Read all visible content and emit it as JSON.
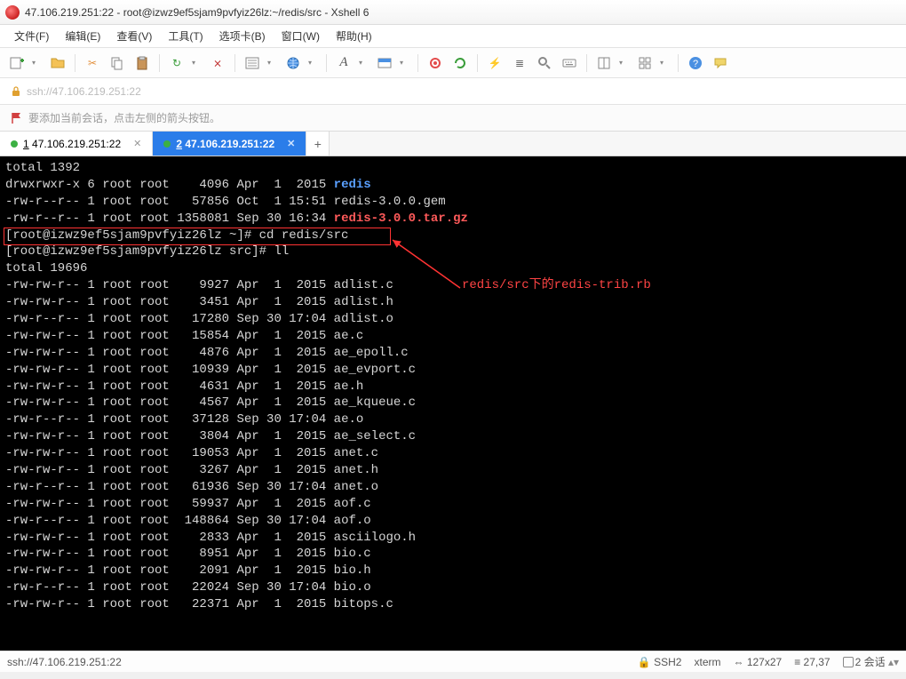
{
  "titlebar": {
    "text": "47.106.219.251:22 - root@izwz9ef5sjam9pvfyiz26lz:~/redis/src - Xshell 6"
  },
  "menu": {
    "file": "文件(F)",
    "edit": "编辑(E)",
    "view": "查看(V)",
    "tools": "工具(T)",
    "tabs": "选项卡(B)",
    "window": "窗口(W)",
    "help": "帮助(H)"
  },
  "address": {
    "url": "ssh://47.106.219.251:22"
  },
  "info": {
    "text": "要添加当前会话，点击左侧的箭头按钮。"
  },
  "tabs": {
    "t1": {
      "label": "1 47.106.219.251:22"
    },
    "t2": {
      "label": "2 47.106.219.251:22"
    }
  },
  "terminal": {
    "lines": [
      {
        "plain": "total 1392"
      },
      {
        "perm": "drwxrwxr-x 6 root root    4096 Apr  1  2015 ",
        "name": "redis",
        "cls": "c-blue"
      },
      {
        "perm": "-rw-r--r-- 1 root root   57856 Oct  1 15:51 ",
        "name": "redis-3.0.0.gem",
        "cls": ""
      },
      {
        "perm": "-rw-r--r-- 1 root root 1358081 Sep 30 16:34 ",
        "name": "redis-3.0.0.tar.gz",
        "cls": "c-red"
      },
      {
        "plain": "[root@izwz9ef5sjam9pvfyiz26lz ~]# cd redis/src"
      },
      {
        "plain": "[root@izwz9ef5sjam9pvfyiz26lz src]# ll"
      },
      {
        "plain": "total 19696"
      },
      {
        "perm": "-rw-rw-r-- 1 root root    9927 Apr  1  2015 ",
        "name": "adlist.c",
        "cls": ""
      },
      {
        "perm": "-rw-rw-r-- 1 root root    3451 Apr  1  2015 ",
        "name": "adlist.h",
        "cls": ""
      },
      {
        "perm": "-rw-r--r-- 1 root root   17280 Sep 30 17:04 ",
        "name": "adlist.o",
        "cls": ""
      },
      {
        "perm": "-rw-rw-r-- 1 root root   15854 Apr  1  2015 ",
        "name": "ae.c",
        "cls": ""
      },
      {
        "perm": "-rw-rw-r-- 1 root root    4876 Apr  1  2015 ",
        "name": "ae_epoll.c",
        "cls": ""
      },
      {
        "perm": "-rw-rw-r-- 1 root root   10939 Apr  1  2015 ",
        "name": "ae_evport.c",
        "cls": ""
      },
      {
        "perm": "-rw-rw-r-- 1 root root    4631 Apr  1  2015 ",
        "name": "ae.h",
        "cls": ""
      },
      {
        "perm": "-rw-rw-r-- 1 root root    4567 Apr  1  2015 ",
        "name": "ae_kqueue.c",
        "cls": ""
      },
      {
        "perm": "-rw-r--r-- 1 root root   37128 Sep 30 17:04 ",
        "name": "ae.o",
        "cls": ""
      },
      {
        "perm": "-rw-rw-r-- 1 root root    3804 Apr  1  2015 ",
        "name": "ae_select.c",
        "cls": ""
      },
      {
        "perm": "-rw-rw-r-- 1 root root   19053 Apr  1  2015 ",
        "name": "anet.c",
        "cls": ""
      },
      {
        "perm": "-rw-rw-r-- 1 root root    3267 Apr  1  2015 ",
        "name": "anet.h",
        "cls": ""
      },
      {
        "perm": "-rw-r--r-- 1 root root   61936 Sep 30 17:04 ",
        "name": "anet.o",
        "cls": ""
      },
      {
        "perm": "-rw-rw-r-- 1 root root   59937 Apr  1  2015 ",
        "name": "aof.c",
        "cls": ""
      },
      {
        "perm": "-rw-r--r-- 1 root root  148864 Sep 30 17:04 ",
        "name": "aof.o",
        "cls": ""
      },
      {
        "perm": "-rw-rw-r-- 1 root root    2833 Apr  1  2015 ",
        "name": "asciilogo.h",
        "cls": ""
      },
      {
        "perm": "-rw-rw-r-- 1 root root    8951 Apr  1  2015 ",
        "name": "bio.c",
        "cls": ""
      },
      {
        "perm": "-rw-rw-r-- 1 root root    2091 Apr  1  2015 ",
        "name": "bio.h",
        "cls": ""
      },
      {
        "perm": "-rw-r--r-- 1 root root   22024 Sep 30 17:04 ",
        "name": "bio.o",
        "cls": ""
      },
      {
        "perm": "-rw-rw-r-- 1 root root   22371 Apr  1  2015 ",
        "name": "bitops.c",
        "cls": ""
      }
    ],
    "annotation": "redis/src下的redis-trib.rb"
  },
  "status": {
    "left": "ssh://47.106.219.251:22",
    "proto": "SSH2",
    "term": "xterm",
    "size": "127x27",
    "pos": "27,37",
    "sess": "2 会话"
  },
  "toolbar_icons": {
    "new": "＋",
    "open": "📄",
    "cut": "✂",
    "copy": "⧉",
    "paste": "📋",
    "reconnect": "↻",
    "disconnect": "⨯",
    "props": "☰",
    "tile": "▦",
    "globe": "🌐",
    "font": "A",
    "color": "▣",
    "rec": "●",
    "refresh": "⟳",
    "bolt": "⚡",
    "scroll": "≣",
    "search": "🔍",
    "term": "⌨",
    "panes": "▤",
    "tiles": "▦",
    "help": "?",
    "chat": "💬"
  }
}
